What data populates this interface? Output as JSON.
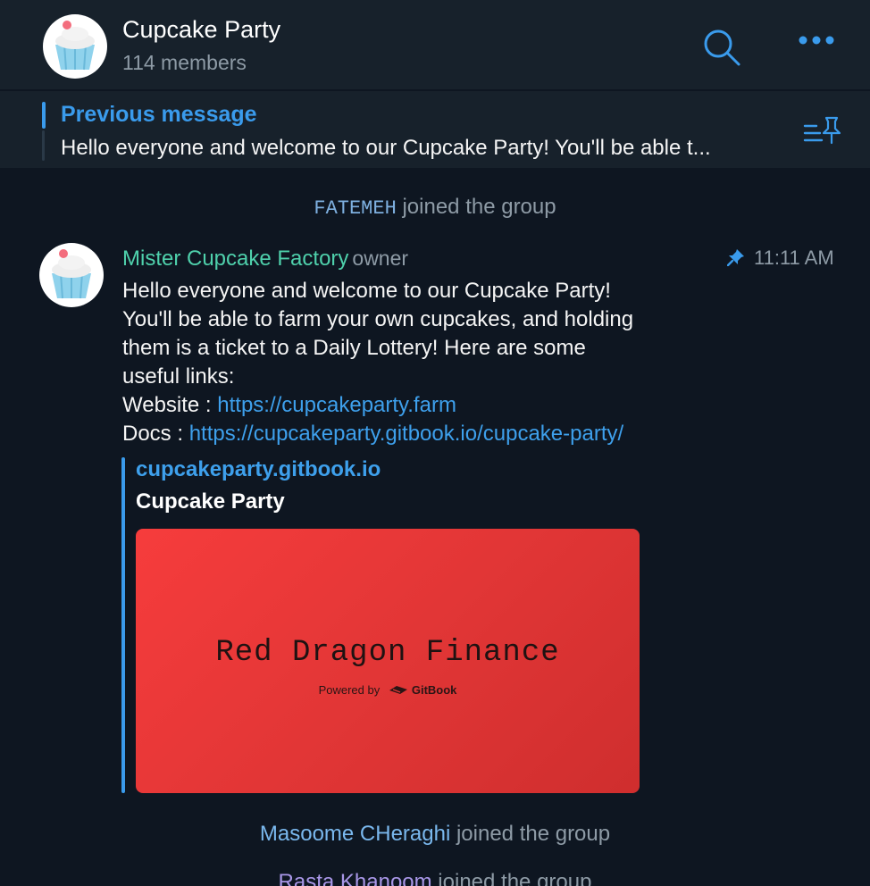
{
  "header": {
    "title": "Cupcake Party",
    "subtitle": "114 members",
    "search_icon": "search-icon",
    "more_icon": "more-dots-icon"
  },
  "pinned": {
    "label": "Previous message",
    "text": "Hello everyone and welcome to our Cupcake Party! You'll be able t...",
    "icon": "pinned-list-icon"
  },
  "events": {
    "joined_1_name": "FATEMEH",
    "joined_1_text": " joined the group",
    "joined_2_name": "Masoome CHeraghi",
    "joined_2_text": " joined the group",
    "joined_3_name": "Rasta Khanoom",
    "joined_3_text": " joined the group"
  },
  "message": {
    "sender": "Mister Cupcake Factory",
    "role": "owner",
    "time": "11:11 AM",
    "pin_icon": "pin-icon",
    "lines": [
      "Hello everyone and welcome to our Cupcake Party!",
      "You'll be able to farm your own cupcakes, and holding",
      "them is a ticket to a Daily Lottery! Here are some",
      "useful links:"
    ],
    "website_label": "Website : ",
    "website_url": "https://cupcakeparty.farm",
    "docs_label": "Docs : ",
    "docs_url": "https://cupcakeparty.gitbook.io/cupcake-party/",
    "preview": {
      "site": "cupcakeparty.gitbook.io",
      "title": "Cupcake Party",
      "image_text": "Red Dragon Finance",
      "powered_by": "Powered by",
      "gitbook": "GitBook"
    }
  },
  "colors": {
    "background": "#0e1621",
    "header": "#17212b",
    "accent": "#3a9bec",
    "owner_name": "#4fd1ac"
  }
}
